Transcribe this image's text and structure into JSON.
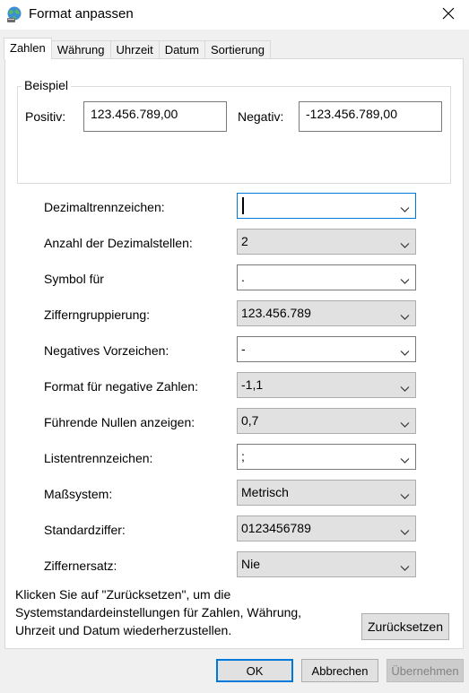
{
  "window": {
    "title": "Format anpassen",
    "app_icon": "globe-settings-icon",
    "close_icon": "close-icon"
  },
  "tabs": [
    {
      "label": "Zahlen",
      "active": true
    },
    {
      "label": "Währung",
      "active": false
    },
    {
      "label": "Uhrzeit",
      "active": false
    },
    {
      "label": "Datum",
      "active": false
    },
    {
      "label": "Sortierung",
      "active": false
    }
  ],
  "example": {
    "legend": "Beispiel",
    "positive_label": "Positiv:",
    "positive_value": "123.456.789,00",
    "negative_label": "Negativ:",
    "negative_value": "-123.456.789,00"
  },
  "settings": [
    {
      "label": "Dezimaltrennzeichen:",
      "value": ","
    },
    {
      "label": "Anzahl der Dezimalstellen:",
      "value": "2"
    },
    {
      "label": "Symbol für",
      "value": "."
    },
    {
      "label": "Zifferngruppierung:",
      "value": "123.456.789"
    },
    {
      "label": "Negatives Vorzeichen:",
      "value": "-"
    },
    {
      "label": "Format für negative Zahlen:",
      "value": "-1,1"
    },
    {
      "label": "Führende Nullen anzeigen:",
      "value": "0,7"
    },
    {
      "label": "Listentrennzeichen:",
      "value": ";"
    },
    {
      "label": "Maßsystem:",
      "value": "Metrisch"
    },
    {
      "label": "Standardziffer:",
      "value": "0123456789"
    },
    {
      "label": "Ziffernersatz:",
      "value": "Nie"
    }
  ],
  "info": {
    "line1": "Klicken Sie auf \"Zurücksetzen\", um die",
    "line2": "Systemstandardeinstellungen für Zahlen, Währung,",
    "line3": "Uhrzeit und Datum wiederherzustellen."
  },
  "buttons": {
    "reset": "Zurücksetzen",
    "ok": "OK",
    "cancel": "Abbrechen",
    "apply": "Übernehmen"
  },
  "colors": {
    "accent": "#0078d7",
    "window_bg": "#f0f0f0",
    "panel_bg": "#ffffff",
    "combo_bg": "#e1e1e1"
  }
}
